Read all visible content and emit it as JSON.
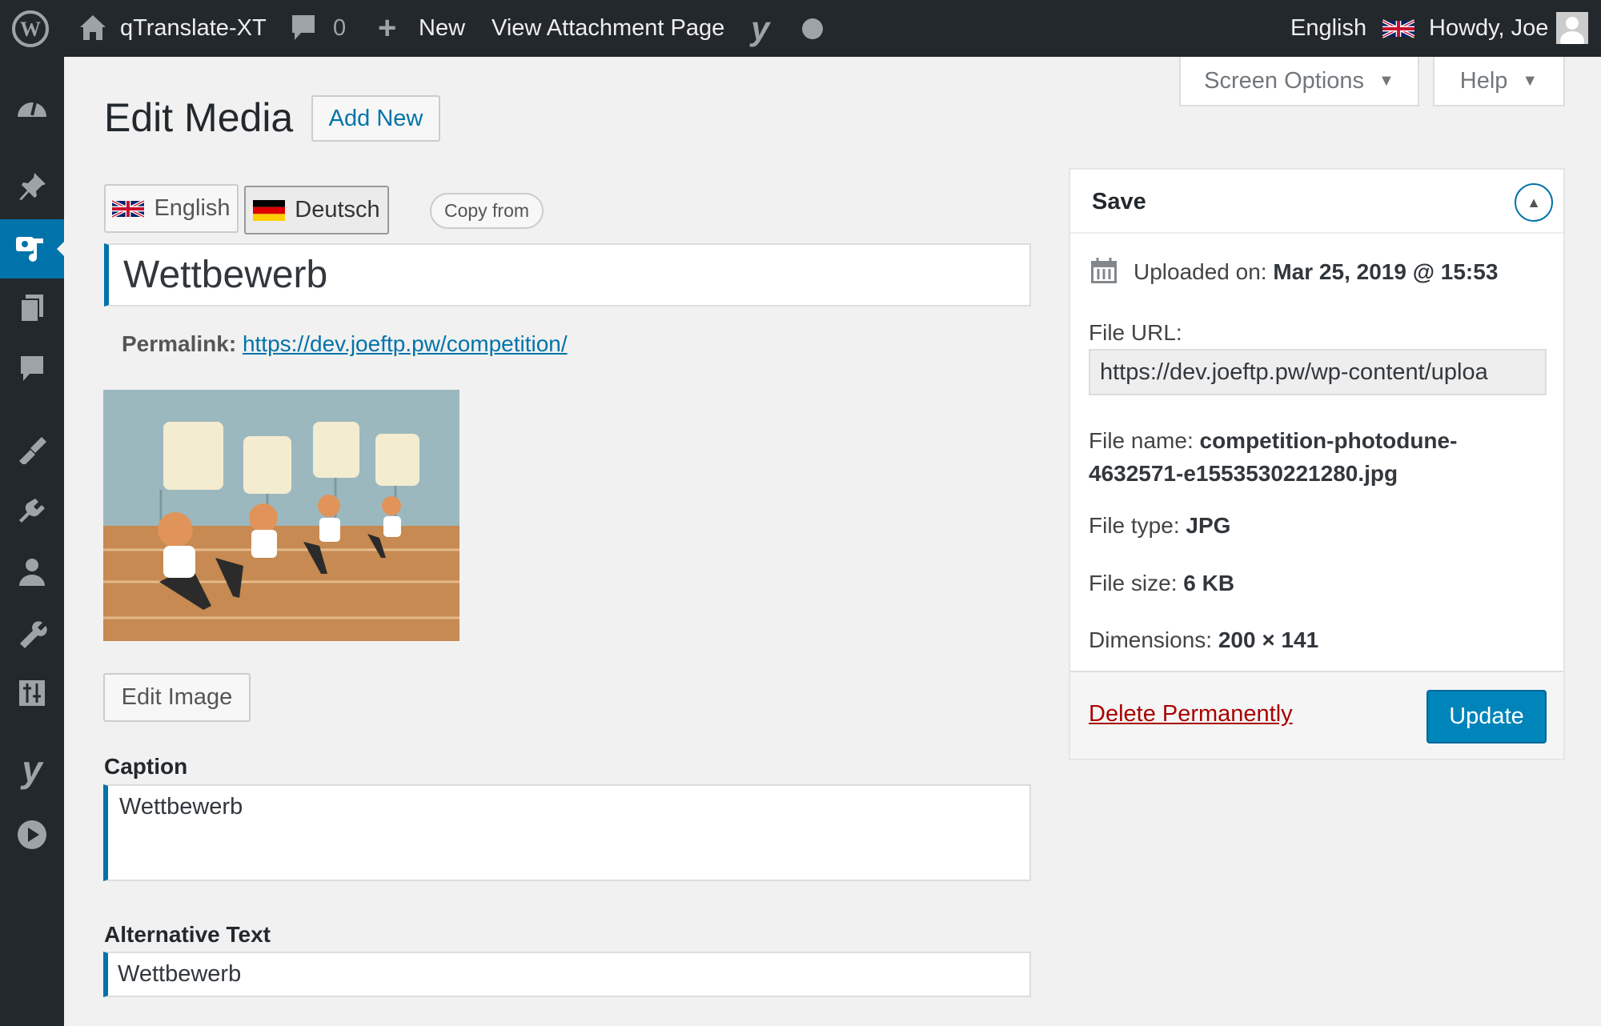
{
  "adminbar": {
    "site_name": "qTranslate-XT",
    "comments_count": "0",
    "new_label": "New",
    "view_label": "View Attachment Page",
    "language": "English",
    "howdy": "Howdy, Joe"
  },
  "sidebar": {
    "items": [
      "dashboard",
      "posts",
      "media",
      "pages",
      "comments",
      "appearance",
      "plugins",
      "users",
      "tools",
      "settings",
      "yoast",
      "media-player"
    ],
    "active": "media"
  },
  "header": {
    "title": "Edit Media",
    "add_new": "Add New",
    "screen_options": "Screen Options",
    "help": "Help"
  },
  "lang_tabs": {
    "english": "English",
    "deutsch": "Deutsch",
    "active": "Deutsch",
    "copy_from": "Copy from"
  },
  "post": {
    "title": "Wettbewerb",
    "permalink_label": "Permalink:",
    "permalink_url": "https://dev.joeftp.pw/competition/",
    "edit_image": "Edit Image",
    "caption_label": "Caption",
    "caption_value": "Wettbewerb",
    "alt_label": "Alternative Text",
    "alt_value": "Wettbewerb"
  },
  "save_box": {
    "title": "Save",
    "uploaded_label": "Uploaded on:",
    "uploaded_value": "Mar 25, 2019 @ 15:53",
    "file_url_label": "File URL:",
    "file_url_value": "https://dev.joeftp.pw/wp-content/uploa",
    "file_name_label": "File name:",
    "file_name_value_1": "competition-photodune-",
    "file_name_value_2": "4632571-e1553530221280.jpg",
    "file_type_label": "File type:",
    "file_type_value": "JPG",
    "file_size_label": "File size:",
    "file_size_value": "6 KB",
    "dimensions_label": "Dimensions:",
    "dimensions_value": "200 × 141",
    "delete_label": "Delete Permanently",
    "update_label": "Update"
  },
  "colors": {
    "accent": "#0073aa",
    "admin_bg": "#23282d",
    "delete": "#a00"
  }
}
